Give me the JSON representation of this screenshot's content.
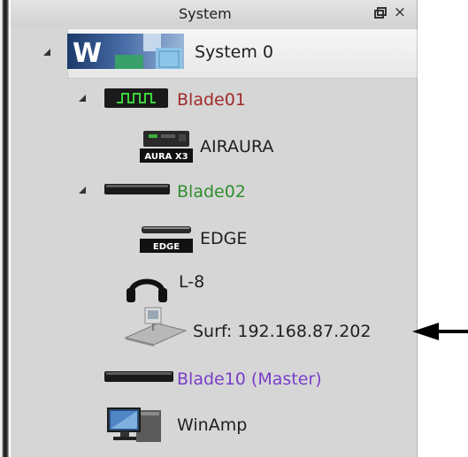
{
  "panel": {
    "title": "System",
    "float_icon": "float-window-icon",
    "close_icon": "close-icon",
    "close_glyph": "×"
  },
  "tree": {
    "root": {
      "label": "System 0",
      "icon": "system-logo-icon",
      "expanded": true
    },
    "blade01": {
      "label": "Blade01",
      "color": "#a12a2a",
      "icon": "blade-waveform-icon",
      "expanded": true
    },
    "airaura": {
      "label": "AIRAURA",
      "icon": "aura-x3-device-icon",
      "device_text": "AURA X3"
    },
    "blade02": {
      "label": "Blade02",
      "color": "#2f8f2f",
      "icon": "blade-bar-icon",
      "expanded": true
    },
    "edge": {
      "label": "EDGE",
      "icon": "edge-device-icon",
      "device_text": "EDGE"
    },
    "l8": {
      "label": "L-8",
      "icon": "headphones-icon"
    },
    "surf": {
      "label": "Surf: 192.168.87.202",
      "icon": "control-surface-icon"
    },
    "blade10": {
      "label": "Blade10 (Master)",
      "color": "#7a3ec8",
      "icon": "blade-bar-icon"
    },
    "winamp": {
      "label": "WinAmp",
      "icon": "computer-icon"
    }
  },
  "annotation": {
    "icon": "pointer-arrow-icon",
    "color": "#000000"
  }
}
